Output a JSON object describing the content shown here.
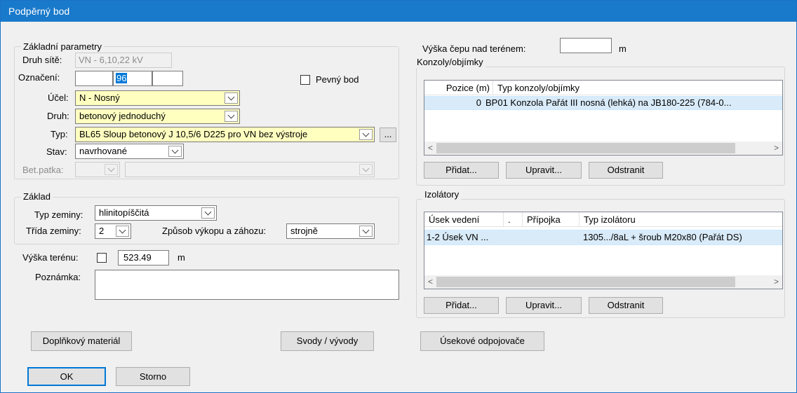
{
  "window": {
    "title": "Podpěrný bod"
  },
  "zakladni": {
    "group_title": "Základní parametry",
    "druh_site_label": "Druh sítě:",
    "druh_site_value": "VN - 6,10,22 kV",
    "oznaceni_label": "Označení:",
    "oznaceni_1": "",
    "oznaceni_2": "96",
    "oznaceni_3": "",
    "pevny_bod_label": "Pevný bod",
    "ucel_label": "Účel:",
    "ucel_value": "N - Nosný",
    "druh_label": "Druh:",
    "druh_value": "betonový jednoduchý",
    "typ_label": "Typ:",
    "typ_value": "BL65  Sloup betonový  J 10,5/6 D225 pro VN bez výstroje",
    "typ_more": "...",
    "stav_label": "Stav:",
    "stav_value": "navrhované",
    "bet_patka_label": "Bet.patka:"
  },
  "zaklad": {
    "group_title": "Základ",
    "typ_zeminy_label": "Typ zeminy:",
    "typ_zeminy_value": "hlinitopíščitá",
    "trida_zeminy_label": "Třída zeminy:",
    "trida_zeminy_value": "2",
    "zpusob_label": "Způsob výkopu a záhozu:",
    "zpusob_value": "strojně"
  },
  "teren": {
    "vyska_terenu_label": "Výška terénu:",
    "vyska_terenu_value": "523.49",
    "unit": "m",
    "poznamka_label": "Poznámka:"
  },
  "cep": {
    "label": "Výška čepu nad terénem:",
    "value": "",
    "unit": "m"
  },
  "konzoly": {
    "group_title": "Konzoly/objímky",
    "col_pozice": "Pozice (m)",
    "col_typ": "Typ konzoly/objímky",
    "row_pozice": "0",
    "row_typ": "BP01  Konzola Pařát III nosná (lehká) na JB180-225 (784-0...",
    "btn_pridat": "Přidat...",
    "btn_upravit": "Upravit...",
    "btn_odstranit": "Odstranit"
  },
  "izolatory": {
    "group_title": "Izolátory",
    "col_usek": "Úsek vedení",
    "col_dot": ".",
    "col_pripojka": "Přípojka",
    "col_typ": "Typ izolátoru",
    "row_usek": "1-2 Úsek VN ...",
    "row_typ": "1305.../8aL + šroub M20x80 (Pařát DS)",
    "btn_pridat": "Přidat...",
    "btn_upravit": "Upravit...",
    "btn_odstranit": "Odstranit"
  },
  "buttons": {
    "doplnkovy": "Doplňkový materiál",
    "svody": "Svody / vývody",
    "usekove": "Úsekové odpojovače",
    "ok": "OK",
    "storno": "Storno"
  },
  "scroll": {
    "left": "<",
    "right": ">"
  },
  "colors": {
    "title_bar": "#1979ca",
    "required_field": "#ffffc0",
    "selected_row": "#d9ebf9"
  }
}
